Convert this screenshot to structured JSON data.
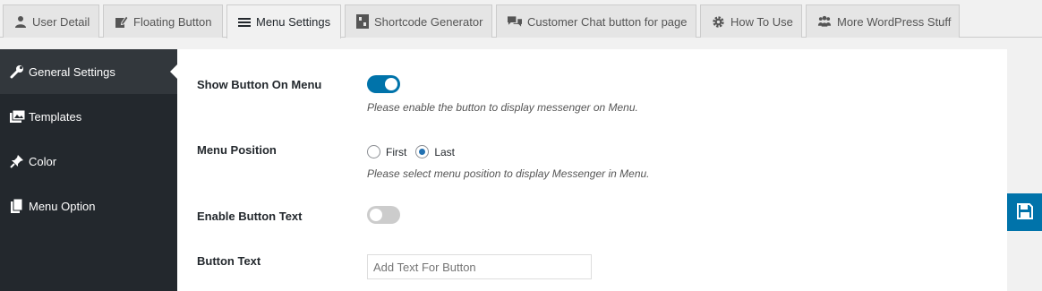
{
  "tabs": [
    {
      "label": "User Detail",
      "icon": "user-icon"
    },
    {
      "label": "Floating Button",
      "icon": "edit-icon"
    },
    {
      "label": "Menu Settings",
      "icon": "menu-icon"
    },
    {
      "label": "Shortcode Generator",
      "icon": "shortcode-icon"
    },
    {
      "label": "Customer Chat button for page",
      "icon": "chat-icon"
    },
    {
      "label": "How To Use",
      "icon": "gear-icon"
    },
    {
      "label": "More WordPress Stuff",
      "icon": "group-icon"
    }
  ],
  "active_tab": "Menu Settings",
  "sidebar": {
    "items": [
      {
        "label": "General Settings",
        "icon": "wrench-icon"
      },
      {
        "label": "Templates",
        "icon": "images-icon"
      },
      {
        "label": "Color",
        "icon": "pin-icon"
      },
      {
        "label": "Menu Option",
        "icon": "pages-icon"
      }
    ],
    "active": "General Settings"
  },
  "form": {
    "show_button": {
      "label": "Show Button On Menu",
      "enabled": true,
      "description": "Please enable the button to display messenger on Menu."
    },
    "menu_position": {
      "label": "Menu Position",
      "options": [
        "First",
        "Last"
      ],
      "selected": "Last",
      "description": "Please select menu position to display Messenger in Menu."
    },
    "enable_button_text": {
      "label": "Enable Button Text",
      "enabled": false
    },
    "button_text": {
      "label": "Button Text",
      "value": "",
      "placeholder": "Add Text For Button"
    }
  },
  "colors": {
    "accent": "#0073aa",
    "sidebar_bg": "#23282d",
    "radio_accent": "#2271b1"
  },
  "save_button": {
    "icon": "save-icon"
  }
}
